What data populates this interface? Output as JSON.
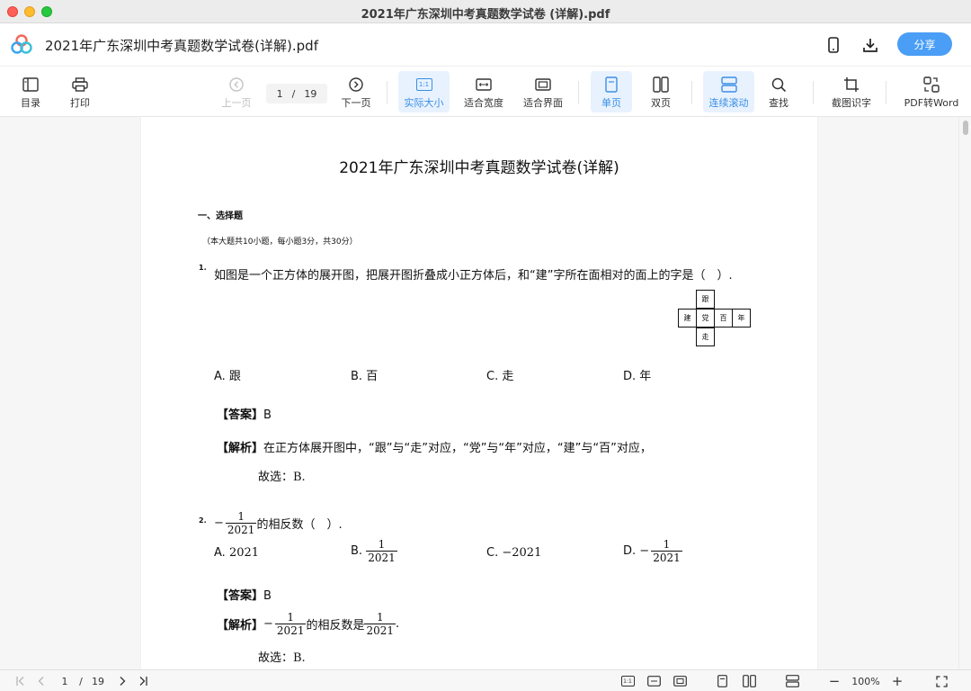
{
  "window": {
    "title": "2021年广东深圳中考真题数学试卷 (详解).pdf"
  },
  "header": {
    "doc_title": "2021年广东深圳中考真题数学试卷(详解).pdf",
    "share_label": "分享"
  },
  "toolbar": {
    "toc": "目录",
    "print": "打印",
    "prev_page": "上一页",
    "page_current": "1",
    "page_sep": "/",
    "page_total": "19",
    "next_page": "下一页",
    "actual_size": "实际大小",
    "actual_size_glyph": "1:1",
    "fit_width": "适合宽度",
    "fit_page": "适合界面",
    "single_page": "单页",
    "two_page": "双页",
    "continuous": "连续滚动",
    "find": "查找",
    "screenshot_ocr": "截图识字",
    "pdf_to_word": "PDF转Word"
  },
  "doc": {
    "title": "2021年广东深圳中考真题数学试卷(详解)",
    "section": "一、选择题",
    "section_note": "（本大题共10小题，每小题3分，共30分）",
    "q1": {
      "num": "1.",
      "text": "如图是一个正方体的展开图，把展开图折叠成小正方体后，和“建”字所在面相对的面上的字是（　）.",
      "net": {
        "top": "跟",
        "left": "建",
        "center": "党",
        "right1": "百",
        "right2": "年",
        "bottom": "走"
      },
      "options": [
        "A. 跟",
        "B. 百",
        "C. 走",
        "D. 年"
      ],
      "answer_label": "【答案】",
      "answer": "B",
      "analysis_label": "【解析】",
      "analysis": "在正方体展开图中，“跟”与“走”对应，“党”与“年”对应，“建”与“百”对应，",
      "choose": "故选：B."
    },
    "q2": {
      "num": "2.",
      "neg": "−",
      "frac_num": "1",
      "frac_den": "2021",
      "text": "的相反数（　）.",
      "optA_label": "A.",
      "optA": "2021",
      "optB_label": "B.",
      "optC_label": "C.",
      "optC": "−2021",
      "optD_label": "D.",
      "answer_label": "【答案】",
      "answer": "B",
      "analysis_label": "【解析】",
      "analysis_mid": "的相反数是",
      "analysis_end": ".",
      "choose": "故选：B."
    }
  },
  "statusbar": {
    "page_current": "1",
    "page_sep": "/",
    "page_total": "19",
    "zoom": "100%",
    "actual_size_glyph": "1:1",
    "minus": "−",
    "plus": "+"
  }
}
